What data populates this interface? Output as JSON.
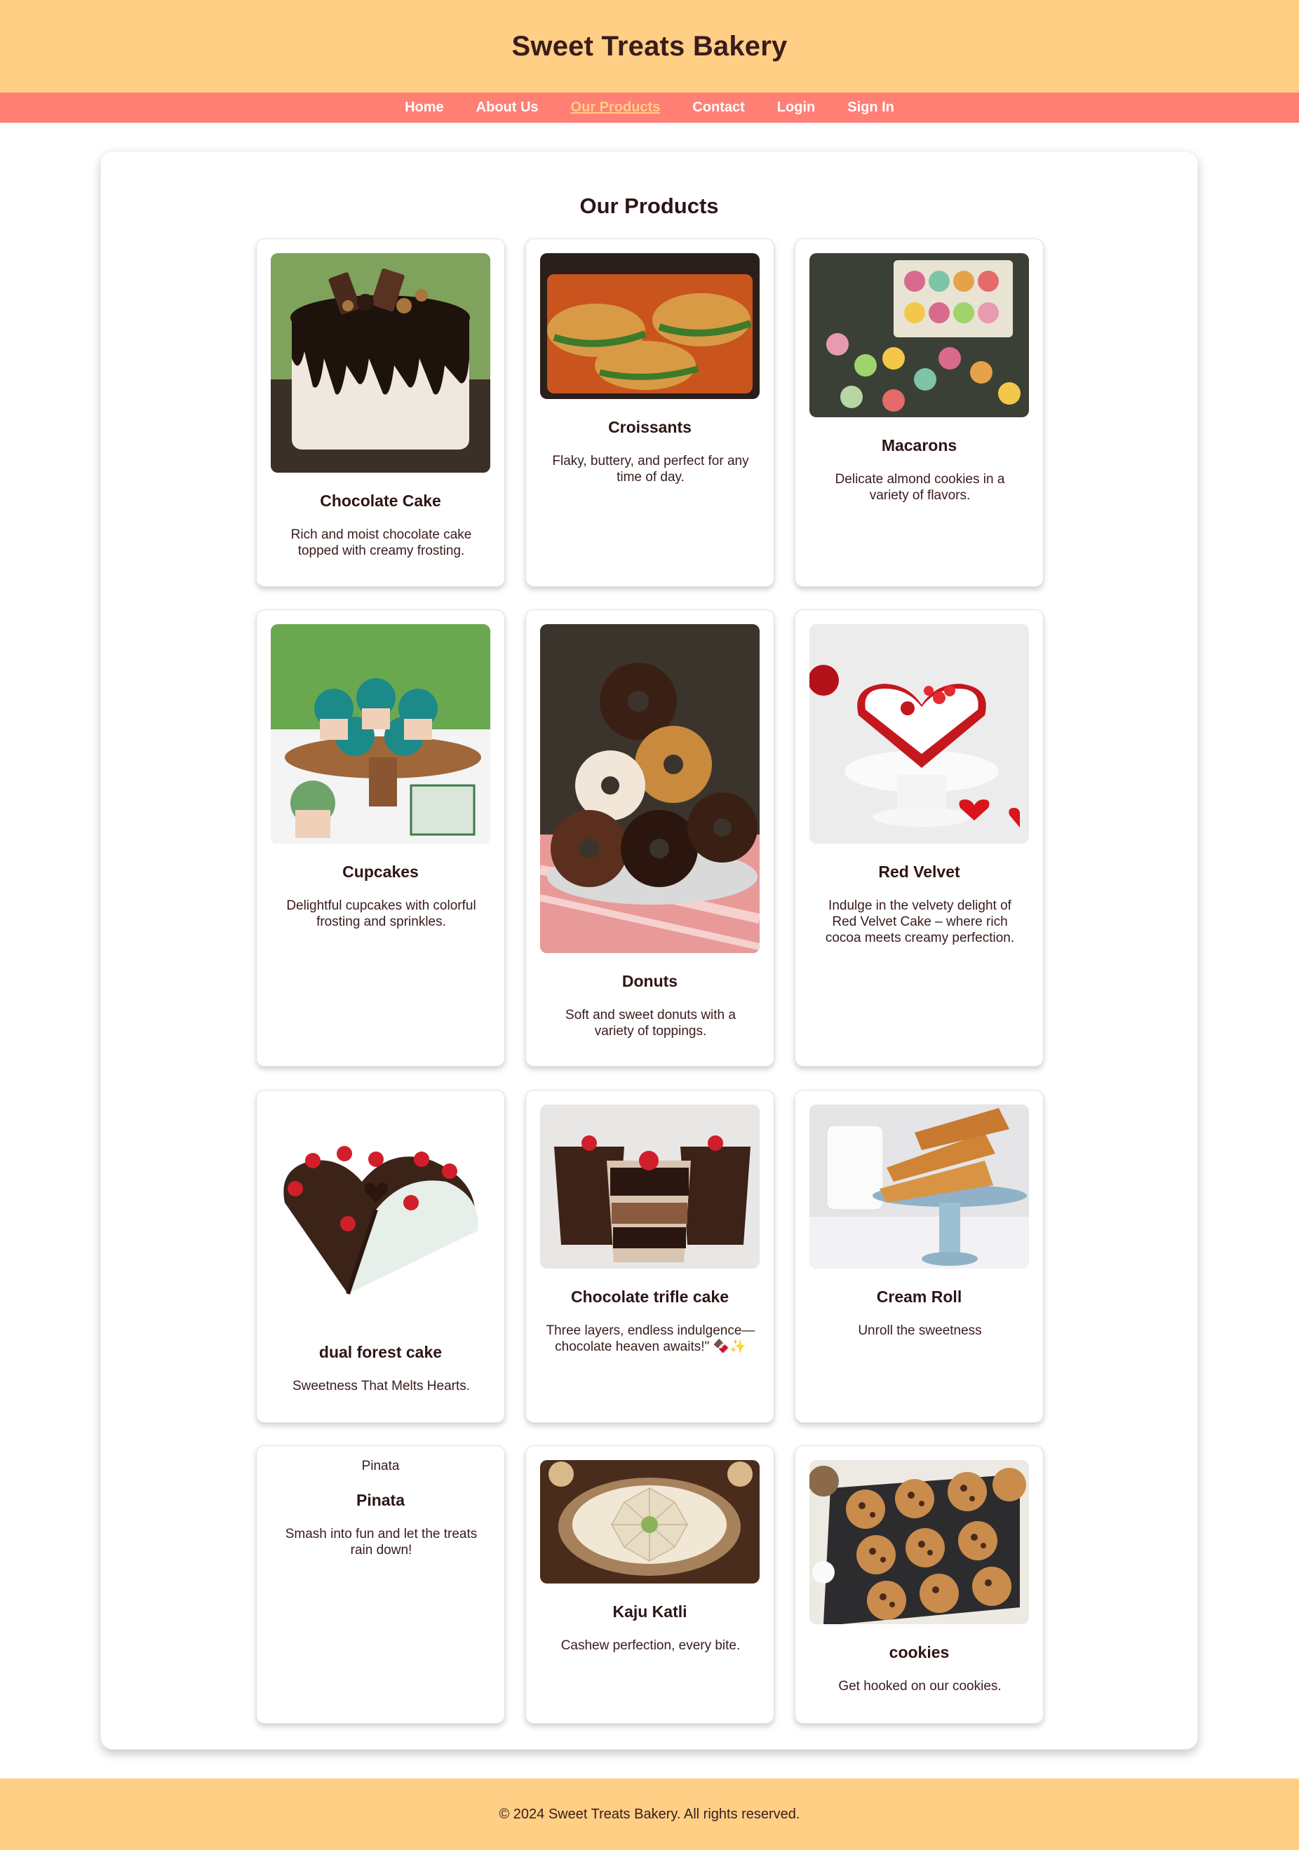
{
  "header": {
    "title": "Sweet Treats Bakery"
  },
  "nav": {
    "items": [
      {
        "label": "Home",
        "active": false
      },
      {
        "label": "About Us",
        "active": false
      },
      {
        "label": "Our Products",
        "active": true
      },
      {
        "label": "Contact",
        "active": false
      },
      {
        "label": "Login",
        "active": false
      },
      {
        "label": "Sign In",
        "active": false
      }
    ]
  },
  "main": {
    "section_title": "Our Products",
    "products": [
      {
        "name": "Chocolate Cake",
        "description": "Rich and moist chocolate cake topped with creamy frosting."
      },
      {
        "name": "Croissants",
        "description": "Flaky, buttery, and perfect for any time of day."
      },
      {
        "name": "Macarons",
        "description": "Delicate almond cookies in a variety of flavors."
      },
      {
        "name": "Cupcakes",
        "description": "Delightful cupcakes with colorful frosting and sprinkles."
      },
      {
        "name": "Donuts",
        "description": "Soft and sweet donuts with a variety of toppings."
      },
      {
        "name": "Red Velvet",
        "description": "Indulge in the velvety delight of Red Velvet Cake – where rich cocoa meets creamy perfection."
      },
      {
        "name": "dual forest cake",
        "description": "Sweetness That Melts Hearts."
      },
      {
        "name": "Chocolate trifle cake",
        "description": "Three layers, endless indulgence—chocolate heaven awaits!\" 🍫✨"
      },
      {
        "name": "Cream Roll",
        "description": "Unroll the sweetness"
      },
      {
        "name": "Pinata",
        "description": "Smash into fun and let the treats rain down!",
        "image_alt": "Pinata"
      },
      {
        "name": "Kaju Katli",
        "description": "Cashew perfection, every bite."
      },
      {
        "name": "cookies",
        "description": "Get hooked on our cookies."
      }
    ]
  },
  "footer": {
    "text": "© 2024 Sweet Treats Bakery. All rights reserved."
  },
  "colors": {
    "header_bg": "#ffcf86",
    "nav_bg": "#ff7f75",
    "nav_active": "#ffcf86",
    "text": "#3a1c1c"
  }
}
